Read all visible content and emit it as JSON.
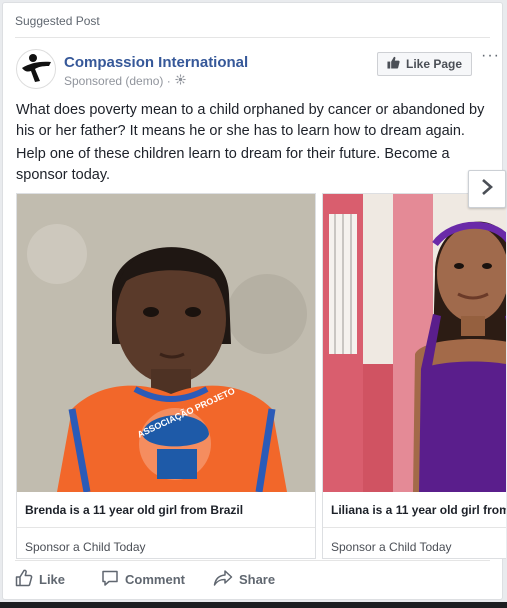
{
  "header": {
    "suggested_label": "Suggested Post"
  },
  "advertiser": {
    "name": "Compassion International",
    "sponsored_label": "Sponsored (demo) ·",
    "like_page_label": "Like Page",
    "more_label": "···"
  },
  "post": {
    "text_1": "What does poverty mean to a child orphaned by cancer or abandoned by his or her father? It means he or she has to learn how to dream again.",
    "text_2": "Help one of these children learn to dream for their future. Become a sponsor today."
  },
  "carousel": {
    "items": [
      {
        "caption": "Brenda is a 11 year old girl from Brazil",
        "cta": "Sponsor a Child Today",
        "shirt_text": "ASSOCIAÇÃO PROJETO"
      },
      {
        "caption": "Liliana is a 11 year old girl from",
        "cta": "Sponsor a Child Today"
      }
    ]
  },
  "actions": {
    "like": "Like",
    "comment": "Comment",
    "share": "Share"
  },
  "colors": {
    "link_blue": "#365899",
    "shirt_orange": "#f2672a",
    "dress_purple": "#5a1e8c"
  }
}
